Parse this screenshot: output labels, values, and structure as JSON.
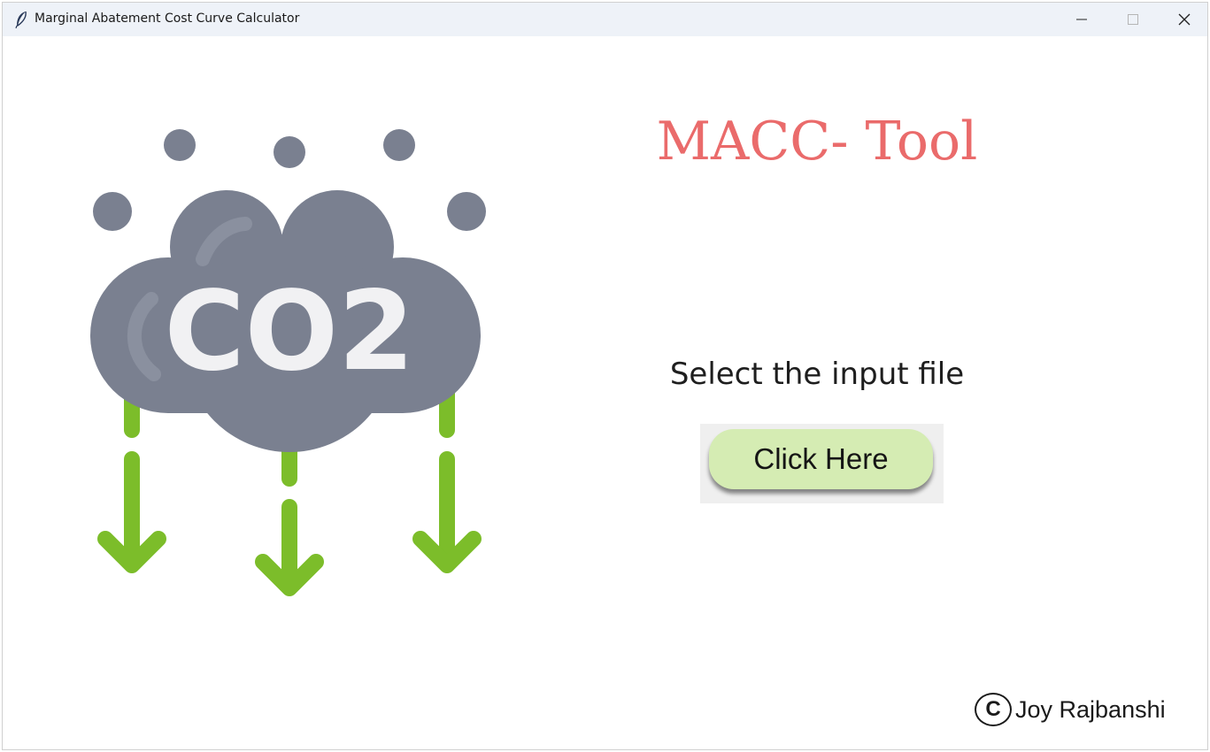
{
  "window": {
    "title": "Marginal Abatement Cost Curve Calculator",
    "app_icon": "feather-icon",
    "controls": [
      "minimize-icon",
      "maximize-icon",
      "close-icon"
    ]
  },
  "illustration": {
    "icon": "co2-cloud-icon",
    "text": "CO2",
    "colors": {
      "cloud": "#7a8090",
      "arrows": "#7cbd2a",
      "text": "#f1f1f3"
    }
  },
  "main": {
    "title": "MACC- Tool",
    "title_color": "#ea6b6b",
    "select_label": "Select the input file",
    "button_label": "Click Here",
    "button_color": "#d5ecb3"
  },
  "footer": {
    "copyright_symbol": "C",
    "author": "Joy Rajbanshi"
  }
}
